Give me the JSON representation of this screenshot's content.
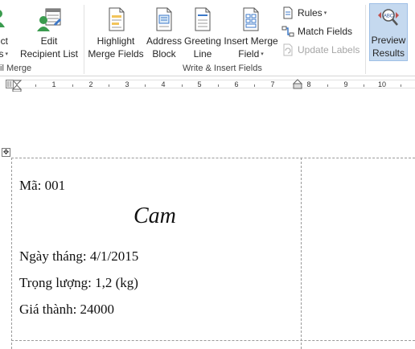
{
  "ribbon": {
    "partial_left": {
      "line1": "ct",
      "line2": "nts",
      "caret": "▾"
    },
    "edit_recipient_list": {
      "line1": "Edit",
      "line2": "Recipient List"
    },
    "group_start_label": "il Merge",
    "highlight_merge_fields": {
      "line1": "Highlight",
      "line2": "Merge Fields"
    },
    "address_block": {
      "line1": "Address",
      "line2": "Block"
    },
    "greeting_line": {
      "line1": "Greeting",
      "line2": "Line"
    },
    "insert_merge_field": {
      "line1": "Insert Merge",
      "line2": "Field",
      "caret": "▾"
    },
    "rules": {
      "label": "Rules",
      "caret": "▾"
    },
    "match_fields": {
      "label": "Match Fields"
    },
    "update_labels": {
      "label": "Update Labels"
    },
    "group_write_label": "Write & Insert Fields",
    "preview_results": {
      "line1": "Preview",
      "line2": "Results",
      "icon_text": "ABC"
    }
  },
  "ruler": {
    "numbers": [
      "1",
      "2",
      "3",
      "4",
      "5",
      "6",
      "7",
      "8",
      "9",
      "10"
    ]
  },
  "document": {
    "move_handle": "✥",
    "ma": "Mã: 001",
    "title": "Cam",
    "ngay_thang": "Ngày tháng: 4/1/2015",
    "trong_luong": "Trọng lượng: 1,2 (kg)",
    "gia_thanh": "Giá thành: 24000"
  },
  "colors": {
    "accent": "#2b579a",
    "active_button_bg": "#c5d9ef",
    "icon_blue": "#3c78c8",
    "icon_green": "#3a9b4e",
    "icon_red": "#c0504d"
  }
}
